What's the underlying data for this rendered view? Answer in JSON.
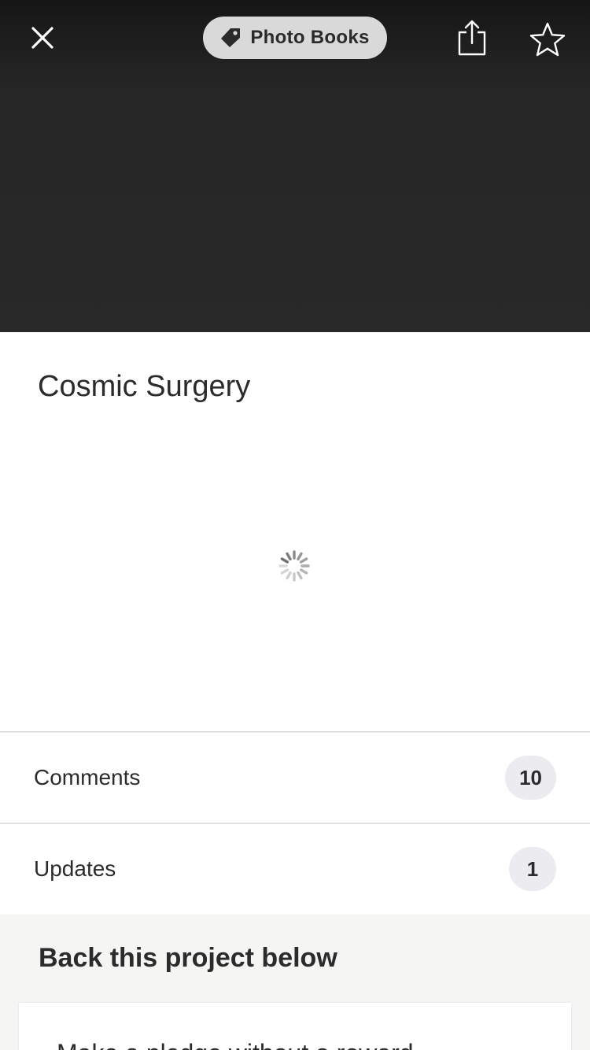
{
  "header": {
    "close_icon": "close-icon",
    "category": {
      "label": "Photo Books",
      "icon": "tag-icon"
    },
    "share_icon": "share-icon",
    "star_icon": "star-icon"
  },
  "project": {
    "title": "Cosmic Surgery",
    "loading_icon": "loading-spinner-icon"
  },
  "rows": {
    "comments": {
      "label": "Comments",
      "count": "10"
    },
    "updates": {
      "label": "Updates",
      "count": "1"
    }
  },
  "back_section": {
    "heading": "Back this project below",
    "reward_text": "Make a pledge without a reward"
  },
  "colors": {
    "hero_background": "#292929",
    "pill_background": "#d9d9d9",
    "badge_background": "#ececf0",
    "section_background": "#f5f5f3",
    "text": "#2b2b2b"
  }
}
